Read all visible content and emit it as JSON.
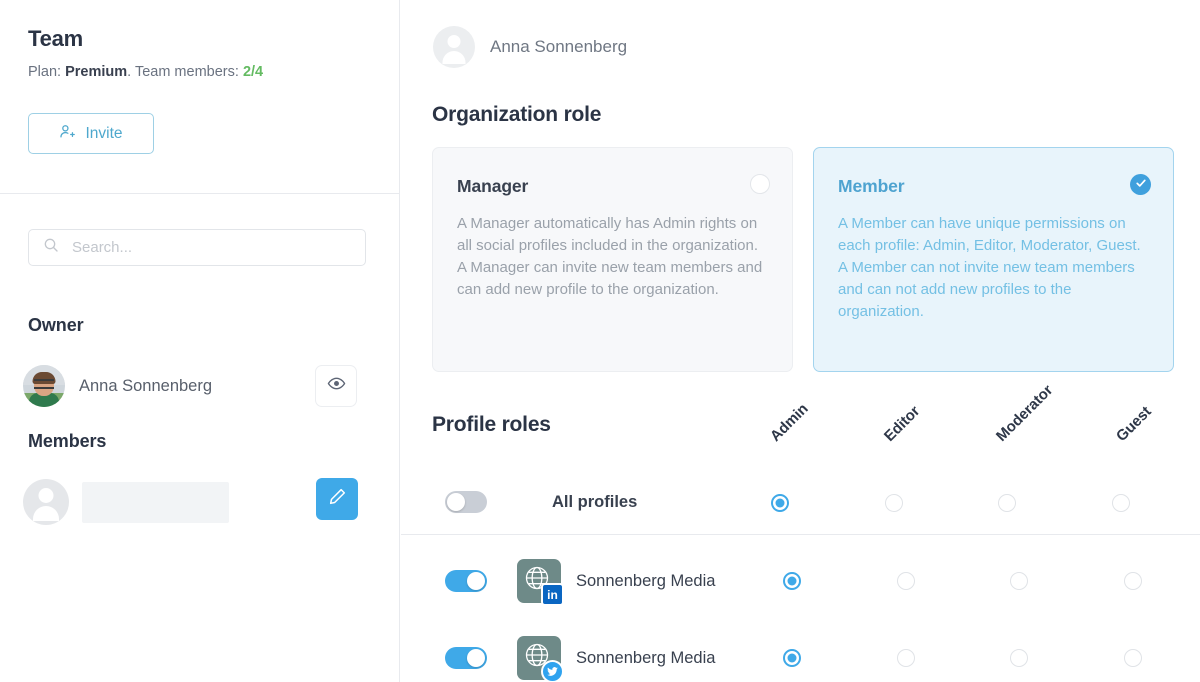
{
  "left": {
    "team_title": "Team",
    "plan_prefix": "Plan: ",
    "plan_name": "Premium",
    "plan_mid": ". Team members: ",
    "plan_count": "2/4",
    "invite_label": "Invite",
    "search_placeholder": "Search...",
    "search_value": "",
    "owner_heading": "Owner",
    "owner_name": "Anna Sonnenberg",
    "members_heading": "Members",
    "member_name": ""
  },
  "right": {
    "user_name": "Anna Sonnenberg",
    "org_role_heading": "Organization role",
    "profile_roles_heading": "Profile roles",
    "roles": [
      {
        "title": "Manager",
        "description": "A Manager automatically has Admin rights on all social profiles included in the organization. A Manager can invite new team members and can add new profile to the organization.",
        "selected": false
      },
      {
        "title": "Member",
        "description": "A Member can have unique permissions on each profile: Admin, Editor, Moderator, Guest. A Member can not invite new team members and can not add new profiles to the organization.",
        "selected": true
      }
    ],
    "columns": [
      "Admin",
      "Editor",
      "Moderator",
      "Guest"
    ],
    "rows": [
      {
        "label": "All profiles",
        "bold": true,
        "toggle_on": false,
        "has_icon": false,
        "network": "",
        "selected_column": 0
      },
      {
        "label": "Sonnenberg Media",
        "bold": false,
        "toggle_on": true,
        "has_icon": true,
        "network": "linkedin",
        "selected_column": 0
      },
      {
        "label": "Sonnenberg Media",
        "bold": false,
        "toggle_on": true,
        "has_icon": true,
        "network": "twitter",
        "selected_column": 0
      }
    ]
  },
  "colors": {
    "accent_blue": "#3fa9e8",
    "link_blue": "#4ea8cd",
    "member_card_bg": "#e8f4fb",
    "member_card_border": "#a3d4ee",
    "member_text": "#74c0e4",
    "green_count": "#64bb62",
    "heading_dark": "#2b3445",
    "profile_icon_bg": "#6e8a88"
  }
}
